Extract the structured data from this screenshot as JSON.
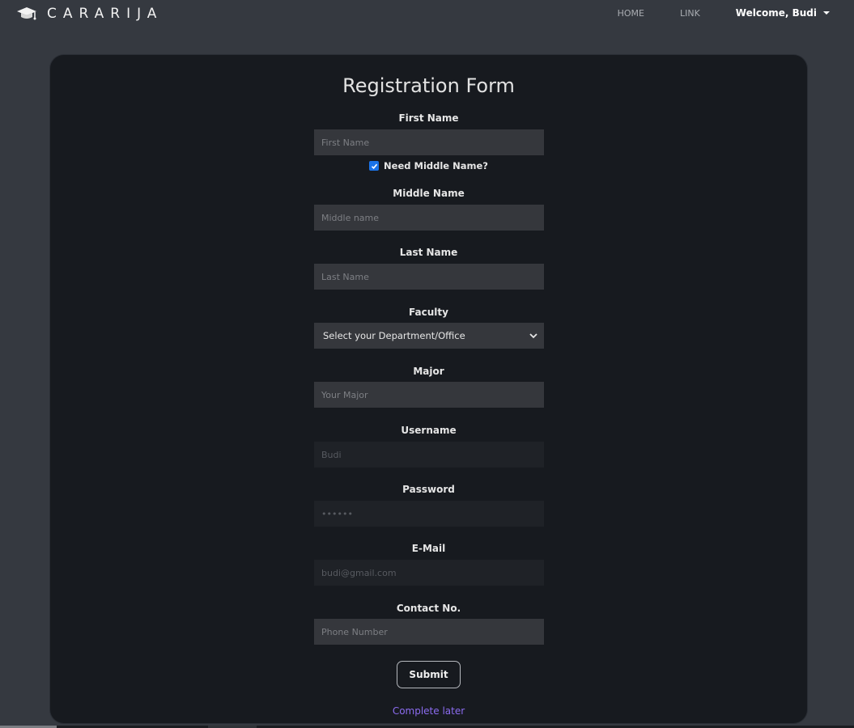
{
  "navbar": {
    "brand_icon": "graduation-cap-icon",
    "brand_name": "CARARIJA",
    "links": [
      "HOME",
      "LINK"
    ],
    "user_label": "Welcome, Budi"
  },
  "form": {
    "title": "Registration Form",
    "first_name": {
      "label": "First Name",
      "placeholder": "First Name",
      "value": ""
    },
    "middle_toggle": {
      "label": "Need Middle Name?",
      "checked": true
    },
    "middle_name": {
      "label": "Middle Name",
      "placeholder": "Middle name",
      "value": ""
    },
    "last_name": {
      "label": "Last Name",
      "placeholder": "Last Name",
      "value": ""
    },
    "faculty": {
      "label": "Faculty",
      "selected": "Select your Department/Office"
    },
    "major": {
      "label": "Major",
      "placeholder": "Your Major",
      "value": ""
    },
    "username": {
      "label": "Username",
      "placeholder": "Budi",
      "value": ""
    },
    "password": {
      "label": "Password",
      "placeholder": "••••••",
      "value": ""
    },
    "email": {
      "label": "E-Mail",
      "placeholder": "budi@gmail.com",
      "value": ""
    },
    "contact": {
      "label": "Contact No.",
      "placeholder": "Phone Number",
      "value": ""
    },
    "submit_label": "Submit",
    "later_label": "Complete later"
  },
  "colors": {
    "page_bg": "#353940",
    "card_bg": "#171a1f",
    "input_bg": "#35373c",
    "disabled_input_bg": "#1f2227",
    "checkbox_accent": "#1a73e8",
    "link_accent": "#8c6cf0"
  }
}
